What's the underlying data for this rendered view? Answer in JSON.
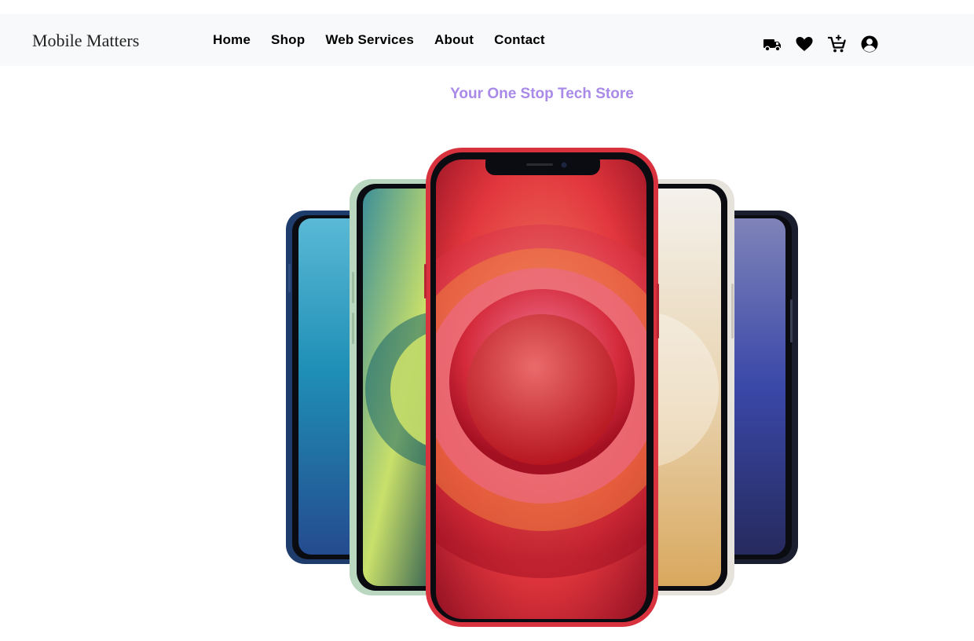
{
  "brand": {
    "name": "Mobile Matters"
  },
  "nav": {
    "links": [
      {
        "label": "Home"
      },
      {
        "label": "Shop"
      },
      {
        "label": "Web Services"
      },
      {
        "label": "About"
      },
      {
        "label": "Contact"
      }
    ],
    "icons": [
      "truck-icon",
      "heart-icon",
      "cart-plus-icon",
      "user-circle-icon"
    ]
  },
  "hero": {
    "tagline": "Your One Stop Tech Store",
    "image": "phone-lineup-image"
  },
  "colors": {
    "navbar_bg": "#f8f9fa",
    "tagline": "#a98ae8",
    "phone_red": "#d8323f",
    "phone_blue": "#1f3f6e",
    "phone_green": "#b7d6bd",
    "phone_white": "#ece8e2",
    "phone_navy": "#23283f"
  }
}
